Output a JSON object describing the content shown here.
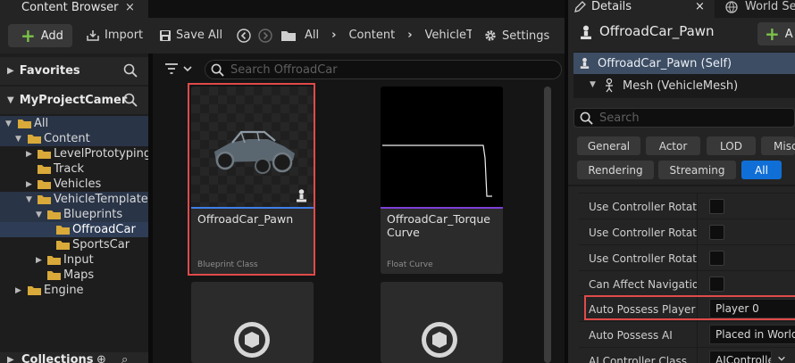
{
  "content_browser": {
    "tab_title": "Content Browser",
    "tab_close": "×",
    "toolbar": {
      "add_label": "Add",
      "import_label": "Import",
      "save_all_label": "Save All",
      "breadcrumb": [
        "All",
        "Content",
        "VehicleT"
      ],
      "settings_label": "Settings"
    },
    "sidebar": {
      "favorites_label": "Favorites",
      "project_label": "MyProjectCamer",
      "collections_label": "Collections",
      "tree": [
        {
          "label": "All",
          "depth": 0,
          "expanded": true
        },
        {
          "label": "Content",
          "depth": 1,
          "expanded": true
        },
        {
          "label": "LevelPrototyping",
          "depth": 2,
          "expanded": false
        },
        {
          "label": "Track",
          "depth": 2,
          "expanded": null
        },
        {
          "label": "Vehicles",
          "depth": 2,
          "expanded": false
        },
        {
          "label": "VehicleTemplate",
          "depth": 2,
          "expanded": true
        },
        {
          "label": "Blueprints",
          "depth": 3,
          "expanded": true
        },
        {
          "label": "OffroadCar",
          "depth": 4,
          "expanded": null
        },
        {
          "label": "SportsCar",
          "depth": 4,
          "expanded": null
        },
        {
          "label": "Input",
          "depth": 3,
          "expanded": false
        },
        {
          "label": "Maps",
          "depth": 3,
          "expanded": null
        },
        {
          "label": "Engine",
          "depth": 1,
          "expanded": false
        }
      ]
    },
    "search_placeholder": "Search OffroadCar",
    "assets": [
      {
        "name": "OffroadCar_Pawn",
        "type": "Blueprint Class",
        "accent": "#3f7ee8",
        "highlighted": true
      },
      {
        "name": "OffroadCar_Torque Curve",
        "type": "Float Curve",
        "accent": "#7b3fd6",
        "highlighted": false
      }
    ]
  },
  "details": {
    "tab_title": "Details",
    "tab_close": "×",
    "world_tab": "World Se",
    "actor_title": "OffroadCar_Pawn",
    "add_label": "A",
    "components": [
      {
        "label": "OffroadCar_Pawn (Self)",
        "selected": true
      },
      {
        "label": "Mesh (VehicleMesh)",
        "selected": false
      }
    ],
    "search_placeholder": "Search",
    "filters_row1": [
      "General",
      "Actor",
      "LOD",
      "Misc"
    ],
    "filters_row2": [
      "Rendering",
      "Streaming",
      "All"
    ],
    "active_filter": "All",
    "properties": [
      {
        "label": "Use Controller Rotati...",
        "kind": "checkbox"
      },
      {
        "label": "Use Controller Rotati...",
        "kind": "checkbox"
      },
      {
        "label": "Use Controller Rotati...",
        "kind": "checkbox"
      },
      {
        "label": "Can Affect Navigatio...",
        "kind": "checkbox"
      },
      {
        "label": "Auto Possess Player",
        "kind": "dropdown",
        "value": "Player 0",
        "highlighted": true
      },
      {
        "label": "Auto Possess AI",
        "kind": "dropdown",
        "value": "Placed in World"
      },
      {
        "label": "AI Controller Class",
        "kind": "dropdown",
        "value": "AIControlle"
      }
    ]
  },
  "colors": {
    "highlight_red": "#e04a4a",
    "accent_blue": "#0f6fd6",
    "add_green": "#7cc24a",
    "folder_yellow": "#d9a93a"
  }
}
